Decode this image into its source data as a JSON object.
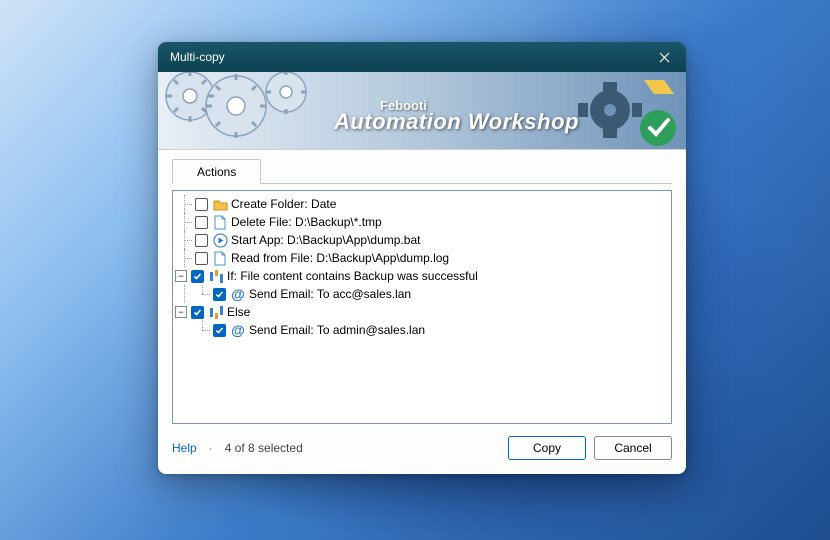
{
  "dialog": {
    "title": "Multi-copy"
  },
  "banner": {
    "brand": "Febooti",
    "product": "Automation Workshop"
  },
  "tabs": {
    "actions": "Actions"
  },
  "tree": {
    "items": [
      {
        "indent": 0,
        "checked": false,
        "icon": "folder",
        "label": "Create Folder: Date",
        "expander": null
      },
      {
        "indent": 0,
        "checked": false,
        "icon": "file",
        "label": "Delete File: D:\\Backup\\*.tmp",
        "expander": null
      },
      {
        "indent": 0,
        "checked": false,
        "icon": "play",
        "label": "Start App: D:\\Backup\\App\\dump.bat",
        "expander": null
      },
      {
        "indent": 0,
        "checked": false,
        "icon": "file",
        "label": "Read from File: D:\\Backup\\App\\dump.log",
        "expander": null
      },
      {
        "indent": 0,
        "checked": true,
        "icon": "if",
        "label": "If: File content contains Backup was successful",
        "expander": "minus"
      },
      {
        "indent": 1,
        "checked": true,
        "icon": "at",
        "label": "Send Email: To acc@sales.lan",
        "expander": null
      },
      {
        "indent": 0,
        "checked": true,
        "icon": "else",
        "label": "Else",
        "expander": "minus"
      },
      {
        "indent": 1,
        "checked": true,
        "icon": "at",
        "label": "Send Email: To admin@sales.lan",
        "expander": null
      }
    ]
  },
  "footer": {
    "help": "Help",
    "status": "4 of 8 selected",
    "copy": "Copy",
    "cancel": "Cancel"
  }
}
